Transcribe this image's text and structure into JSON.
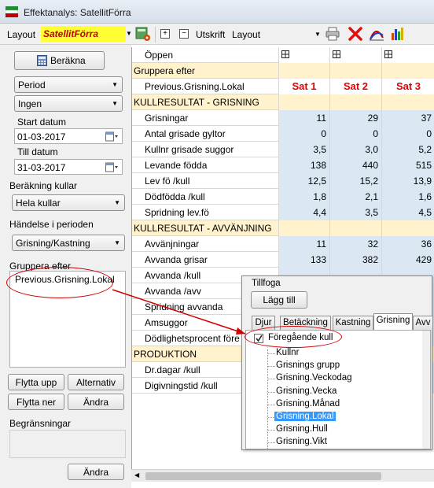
{
  "window": {
    "title": "Effektanalys: SatellitFörra"
  },
  "toolbar": {
    "layout_label": "Layout",
    "layout_value": "SatellitFörra",
    "print_label": "Utskrift",
    "print_combo": "Layout",
    "expand_symbol": "+",
    "collapse_symbol": "−"
  },
  "left": {
    "calc_button": "Beräkna",
    "period_combo": "Period",
    "ingen_combo": "Ingen",
    "start_label": "Start datum",
    "start_date": "01-03-2017",
    "end_label": "Till datum",
    "end_date": "31-03-2017",
    "calc_litters_label": "Beräkning kullar",
    "calc_litters_value": "Hela kullar",
    "event_label": "Händelse i perioden",
    "event_value": "Grisning/Kastning",
    "group_label": "Gruppera efter",
    "group_items": [
      "Previous.Grisning.Lokal"
    ],
    "move_up": "Flytta upp",
    "alternative": "Alternativ",
    "move_down": "Flytta ner",
    "change1": "Ändra",
    "limits_label": "Begränsningar",
    "change2": "Ändra"
  },
  "grid": {
    "columns": [
      "Sat 1",
      "Sat 2",
      "Sat 3"
    ],
    "rows": [
      {
        "label": "Öppen",
        "type": "open"
      },
      {
        "label": "Gruppera efter",
        "type": "section"
      },
      {
        "label": "Previous.Grisning.Lokal",
        "type": "header"
      },
      {
        "label": "KULLRESULTAT - GRISNING",
        "type": "section"
      },
      {
        "label": "Grisningar",
        "type": "data",
        "values": [
          "11",
          "29",
          "37"
        ]
      },
      {
        "label": "Antal grisade gyltor",
        "type": "data",
        "values": [
          "0",
          "0",
          "0"
        ]
      },
      {
        "label": "Kullnr grisade suggor",
        "type": "data",
        "values": [
          "3,5",
          "3,0",
          "5,2"
        ]
      },
      {
        "label": "Levande födda",
        "type": "data",
        "values": [
          "138",
          "440",
          "515"
        ]
      },
      {
        "label": "Lev fö /kull",
        "type": "data",
        "values": [
          "12,5",
          "15,2",
          "13,9"
        ]
      },
      {
        "label": "Dödfödda /kull",
        "type": "data",
        "values": [
          "1,8",
          "2,1",
          "1,6"
        ]
      },
      {
        "label": "Spridning lev.fö",
        "type": "data",
        "values": [
          "4,4",
          "3,5",
          "4,5"
        ]
      },
      {
        "label": "KULLRESULTAT - AVVÄNJNING",
        "type": "section"
      },
      {
        "label": "Avvänjningar",
        "type": "data",
        "values": [
          "11",
          "32",
          "36"
        ]
      },
      {
        "label": "Avvanda grisar",
        "type": "data",
        "values": [
          "133",
          "382",
          "429"
        ]
      },
      {
        "label": "Avvanda /kull",
        "type": "data",
        "values": [
          "",
          "",
          ""
        ]
      },
      {
        "label": "Avvanda /avv",
        "type": "data",
        "values": [
          "",
          "",
          ""
        ]
      },
      {
        "label": "Spridning avvanda",
        "type": "data",
        "values": [
          "",
          "",
          ""
        ]
      },
      {
        "label": "Amsuggor",
        "type": "data",
        "values": [
          "",
          "",
          ""
        ]
      },
      {
        "label": "Dödlighetsprocent före avv",
        "type": "data",
        "values": [
          "",
          "",
          ""
        ]
      },
      {
        "label": "PRODUKTION",
        "type": "section"
      },
      {
        "label": "Dr.dagar /kull",
        "type": "data",
        "values": [
          "",
          "",
          ""
        ]
      },
      {
        "label": "Digivningstid /kull",
        "type": "data",
        "values": [
          "",
          "",
          ""
        ]
      }
    ]
  },
  "popup": {
    "title": "Tillfoga",
    "add_button": "Lägg till",
    "tabs": [
      "Djur",
      "Betäckning",
      "Kastning",
      "Grisning",
      "Avv"
    ],
    "active_tab": "Grisning",
    "checkbox_label": "Föregående kull",
    "checkbox_checked": true,
    "tree_items": [
      "Kullnr",
      "Grisnings grupp",
      "Grisning.Veckodag",
      "Grisning.Vecka",
      "Grisning.Månad",
      "Grisning.Lokal",
      "Grisning.Hull",
      "Grisning.Vikt"
    ],
    "selected_item": "Grisning.Lokal"
  },
  "colors": {
    "annotation": "#d00000",
    "section_bg": "#fff2cc",
    "data_bg": "#dbe8f4",
    "layout_bg": "#ffff33"
  }
}
